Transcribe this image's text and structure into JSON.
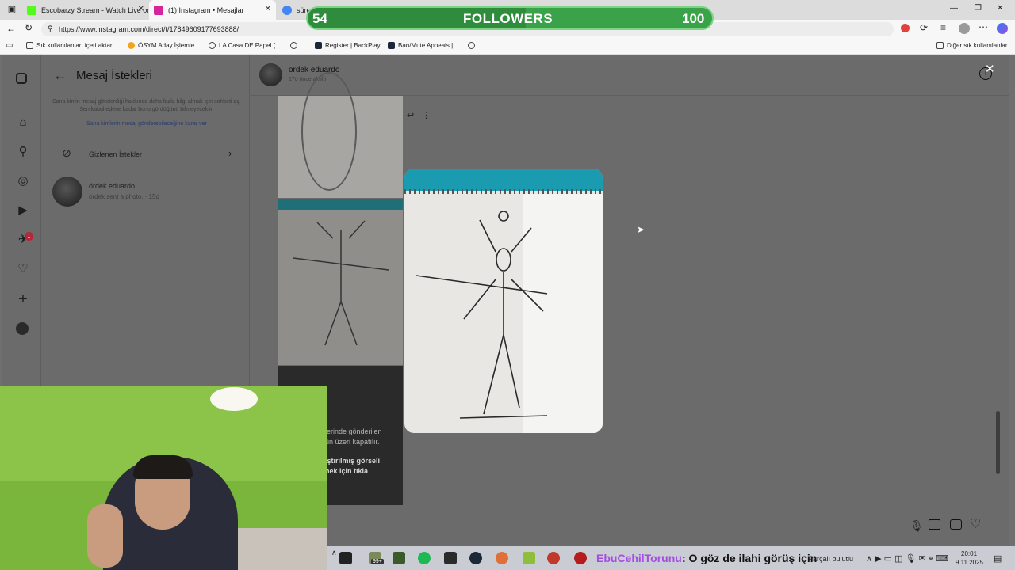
{
  "browser": {
    "tabs": [
      {
        "title": "Escobarzy Stream - Watch Live on",
        "fav_color": "#53fc18"
      },
      {
        "title": "(1) Instagram • Mesajlar",
        "fav_color": "#d6249f"
      },
      {
        "title": "sürek",
        "fav_color": "#4285f4"
      }
    ],
    "url": "https://www.instagram.com/direct/t/17849609177693888/",
    "bookmarks": [
      "Sık kullanılanları içeri aktar",
      "ÖSYM Aday İşlemle...",
      "LA Casa DE Papel (...",
      "Register | BackPlay",
      "Ban/Mute Appeals |...",
      "Diğer sık kullanılanlar"
    ],
    "window_controls": [
      "—",
      "❐",
      "✕"
    ]
  },
  "overlay": {
    "followers_current": "54",
    "followers_label": "FOLLOWERS",
    "followers_goal": "100",
    "progress": 0.54
  },
  "instagram": {
    "rail_icons": [
      "instagram-icon",
      "home-icon",
      "search-icon",
      "explore-icon",
      "reels-icon",
      "messenger-icon",
      "heart-icon",
      "plus-icon",
      "profile-icon"
    ],
    "notification_count": "1",
    "requests": {
      "title": "Mesaj İstekleri",
      "info": "Sana kimin mesaj gönderdiği hakkında daha fazla bilgi almak için sohbeti aç. Sen kabul edene kadar bunu gördüğünü bilmeyecektir.",
      "link": "Sana kimlerin mesaj gönderebileceğine karar ver",
      "hidden_label": "Gizlenen İstekler",
      "thread_name": "ördek eduardo",
      "thread_preview": "ördek sent a photo. · 15d"
    },
    "chat": {
      "name": "ördek eduardo",
      "status": "17d önce aktifti",
      "notice_line1": "lerinde gönderilen",
      "notice_line2": "ün üzeri kapatılır.",
      "notice_line3": "ıştırılmış görseli",
      "notice_line4": "nek için tıkla"
    }
  },
  "stream_chat": {
    "user": "EbuCehilTorunu",
    "message": ": O göz de ilahi görüş için"
  },
  "taskbar": {
    "badge": "99+",
    "tray_text": "Parçalı bulutlu",
    "time": "20:01",
    "date": "9.11.2025"
  }
}
